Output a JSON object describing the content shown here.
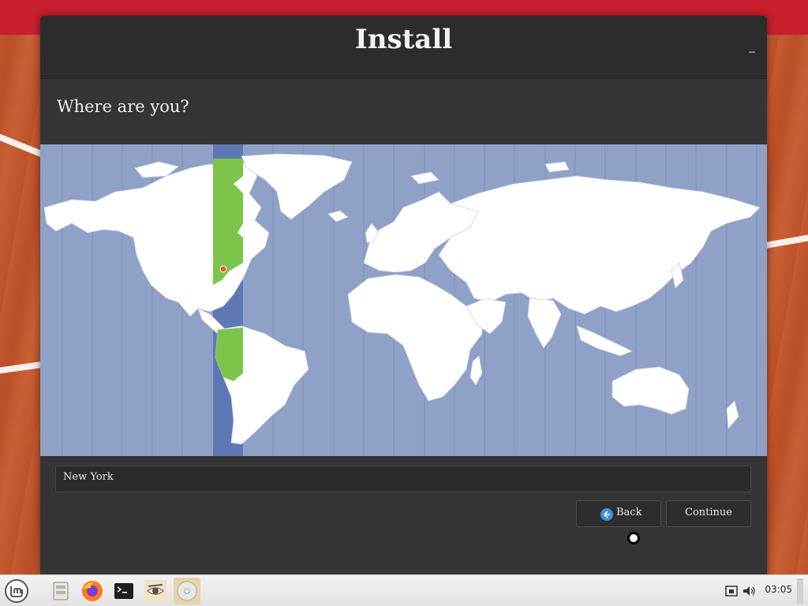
{
  "window": {
    "title": "Install",
    "minimize_glyph": "_"
  },
  "page": {
    "heading": "Where are you?"
  },
  "location": {
    "city": "New York",
    "highlight_color": "#7cc44a",
    "ocean_color": "#8fa1c6",
    "timezone_band_color": "#5f78b5",
    "marker_color": "#e05a3a"
  },
  "buttons": {
    "back_label": "Back",
    "continue_label": "Continue"
  },
  "taskbar": {
    "items": [
      {
        "name": "mint-menu-icon"
      },
      {
        "name": "file-manager-icon"
      },
      {
        "name": "firefox-icon"
      },
      {
        "name": "terminal-icon"
      },
      {
        "name": "installer-eye-icon"
      },
      {
        "name": "disc-icon"
      }
    ],
    "clock": "03:05"
  }
}
